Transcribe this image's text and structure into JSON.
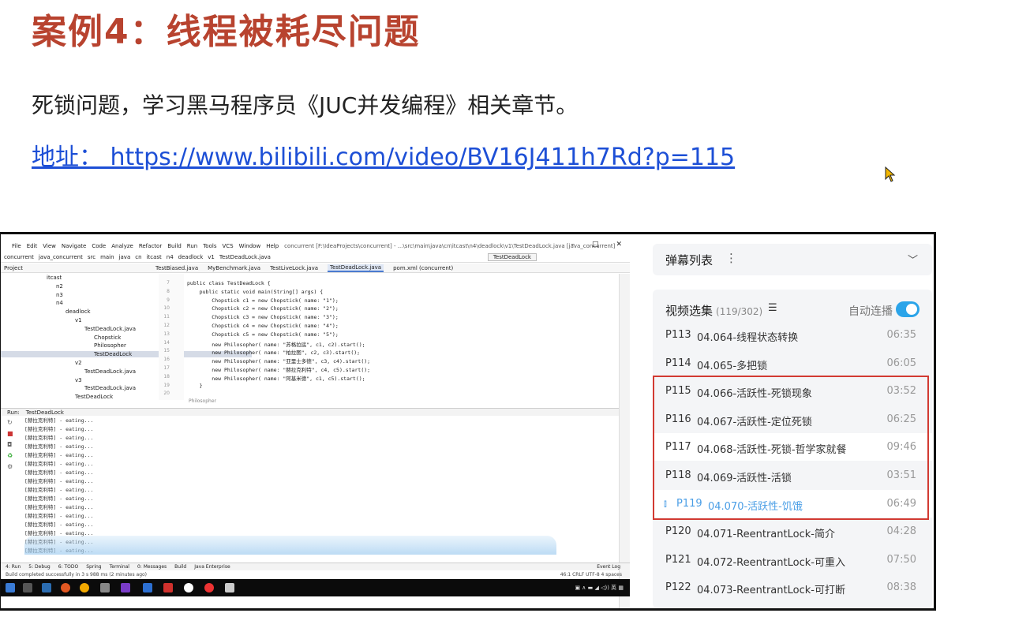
{
  "slide": {
    "title": "案例4：线程被耗尽问题",
    "line1": "死锁问题，学习黑马程序员《JUC并发编程》相关章节。",
    "link": "地址：  https://www.bilibili.com/video/BV16J411h7Rd?p=115"
  },
  "ide": {
    "menu": [
      "File",
      "Edit",
      "View",
      "Navigate",
      "Code",
      "Analyze",
      "Refactor",
      "Build",
      "Run",
      "Tools",
      "VCS",
      "Window",
      "Help"
    ],
    "window_title": "concurrent [F:\\IdeaProjects\\concurrent] - ...\\src\\main\\java\\cn\\itcast\\n4\\deadlock\\v1\\TestDeadLock.java [java_concurrent]",
    "breadcrumb": [
      "concurrent",
      "java_concurrent",
      "src",
      "main",
      "java",
      "cn",
      "itcast",
      "n4",
      "deadlock",
      "v1",
      "TestDeadLock.java"
    ],
    "run_config": "TestDeadLock",
    "project_label": "Project",
    "tabs": [
      "TestBiased.java",
      "MyBenchmark.java",
      "TestLiveLock.java",
      "TestDeadLock.java",
      "pom.xml (concurrent)"
    ],
    "active_tab": "TestDeadLock.java",
    "tree": [
      {
        "label": "itcast",
        "indent": 4
      },
      {
        "label": "n2",
        "indent": 5
      },
      {
        "label": "n3",
        "indent": 5
      },
      {
        "label": "n4",
        "indent": 5
      },
      {
        "label": "deadlock",
        "indent": 6
      },
      {
        "label": "v1",
        "indent": 7
      },
      {
        "label": "TestDeadLock.java",
        "indent": 8
      },
      {
        "label": "Chopstick",
        "indent": 9
      },
      {
        "label": "Philosopher",
        "indent": 9
      },
      {
        "label": "TestDeadLock",
        "indent": 9
      },
      {
        "label": "v2",
        "indent": 7
      },
      {
        "label": "TestDeadLock.java",
        "indent": 8
      },
      {
        "label": "v3",
        "indent": 7
      },
      {
        "label": "TestDeadLock.java",
        "indent": 8
      },
      {
        "label": "TestDeadLock",
        "indent": 7
      }
    ],
    "gutter": [
      "7",
      "8",
      "9",
      "10",
      "11",
      "12",
      "13",
      "14",
      "15",
      "16",
      "17",
      "18",
      "19",
      "20"
    ],
    "code_lines": [
      {
        "pre": "public class ",
        "kw": "",
        "text": "public class TestDeadLock {"
      },
      {
        "text": "    public static void main(String[] args) {"
      },
      {
        "text": "        Chopstick c1 = new Chopstick( name: \"1\");"
      },
      {
        "text": "        Chopstick c2 = new Chopstick( name: \"2\");"
      },
      {
        "text": "        Chopstick c3 = new Chopstick( name: \"3\");"
      },
      {
        "text": "        Chopstick c4 = new Chopstick( name: \"4\");"
      },
      {
        "text": "        Chopstick c5 = new Chopstick( name: \"5\");"
      },
      {
        "text": "        new Philosopher( name: \"苏格拉底\", c1, c2).start();"
      },
      {
        "text": "        new Philosopher( name: \"柏拉图\", c2, c3).start();"
      },
      {
        "text": "        new Philosopher( name: \"亚里士多德\", c3, c4).start();"
      },
      {
        "text": "        new Philosopher( name: \"赫拉克利特\", c4, c5).start();"
      },
      {
        "text": "        new Philosopher( name: \"阿基米德\", c1, c5).start();"
      },
      {
        "text": "    }"
      }
    ],
    "code_crumb": "Philosopher",
    "run_label": "Run:",
    "run_tab": "TestDeadLock",
    "console_lines": [
      "[赫拉克利特] - eating...",
      "[赫拉克利特] - eating...",
      "[赫拉克利特] - eating...",
      "[赫拉克利特] - eating...",
      "[赫拉克利特] - eating...",
      "[赫拉克利特] - eating...",
      "[赫拉克利特] - eating...",
      "[赫拉克利特] - eating...",
      "[赫拉克利特] - eating...",
      "[赫拉克利特] - eating...",
      "[赫拉克利特] - eating...",
      "[赫拉克利特] - eating...",
      "[赫拉克利特] - eating...",
      "[赫拉克利特] - eating...",
      "[赫拉克利特] - eating...",
      "[赫拉克利特] - eating..."
    ],
    "bottom_tabs": [
      "4: Run",
      "5: Debug",
      "6: TODO",
      "Spring",
      "Terminal",
      "0: Messages",
      "Build",
      "Java Enterprise",
      "Event Log"
    ],
    "status_text": "Build completed successfully in 3 s 988 ms (2 minutes ago)",
    "status_right": "46:1   CRLF   UTF-8   4 spaces"
  },
  "panel": {
    "danmaku_title": "弹幕列表",
    "list_title": "视频选集",
    "list_count": "(119/302)",
    "autoplay_label": "自动连播",
    "autoplay_on": true,
    "accent": "#2ba4e9",
    "highlight_color": "#d23a32",
    "episodes": [
      {
        "code": "P113",
        "name": "04.064-线程状态转换",
        "duration": "06:35"
      },
      {
        "code": "P114",
        "name": "04.065-多把锁",
        "duration": "06:05"
      },
      {
        "code": "P115",
        "name": "04.066-活跃性-死锁现象",
        "duration": "03:52"
      },
      {
        "code": "P116",
        "name": "04.067-活跃性-定位死锁",
        "duration": "06:25"
      },
      {
        "code": "P117",
        "name": "04.068-活跃性-死锁-哲学家就餐",
        "duration": "09:46"
      },
      {
        "code": "P118",
        "name": "04.069-活跃性-活锁",
        "duration": "03:51"
      },
      {
        "code": "P119",
        "name": "04.070-活跃性-饥饿",
        "duration": "06:49"
      },
      {
        "code": "P120",
        "name": "04.071-ReentrantLock-简介",
        "duration": "04:28"
      },
      {
        "code": "P121",
        "name": "04.072-ReentrantLock-可重入",
        "duration": "07:50"
      },
      {
        "code": "P122",
        "name": "04.073-ReentrantLock-可打断",
        "duration": "08:38"
      }
    ]
  }
}
